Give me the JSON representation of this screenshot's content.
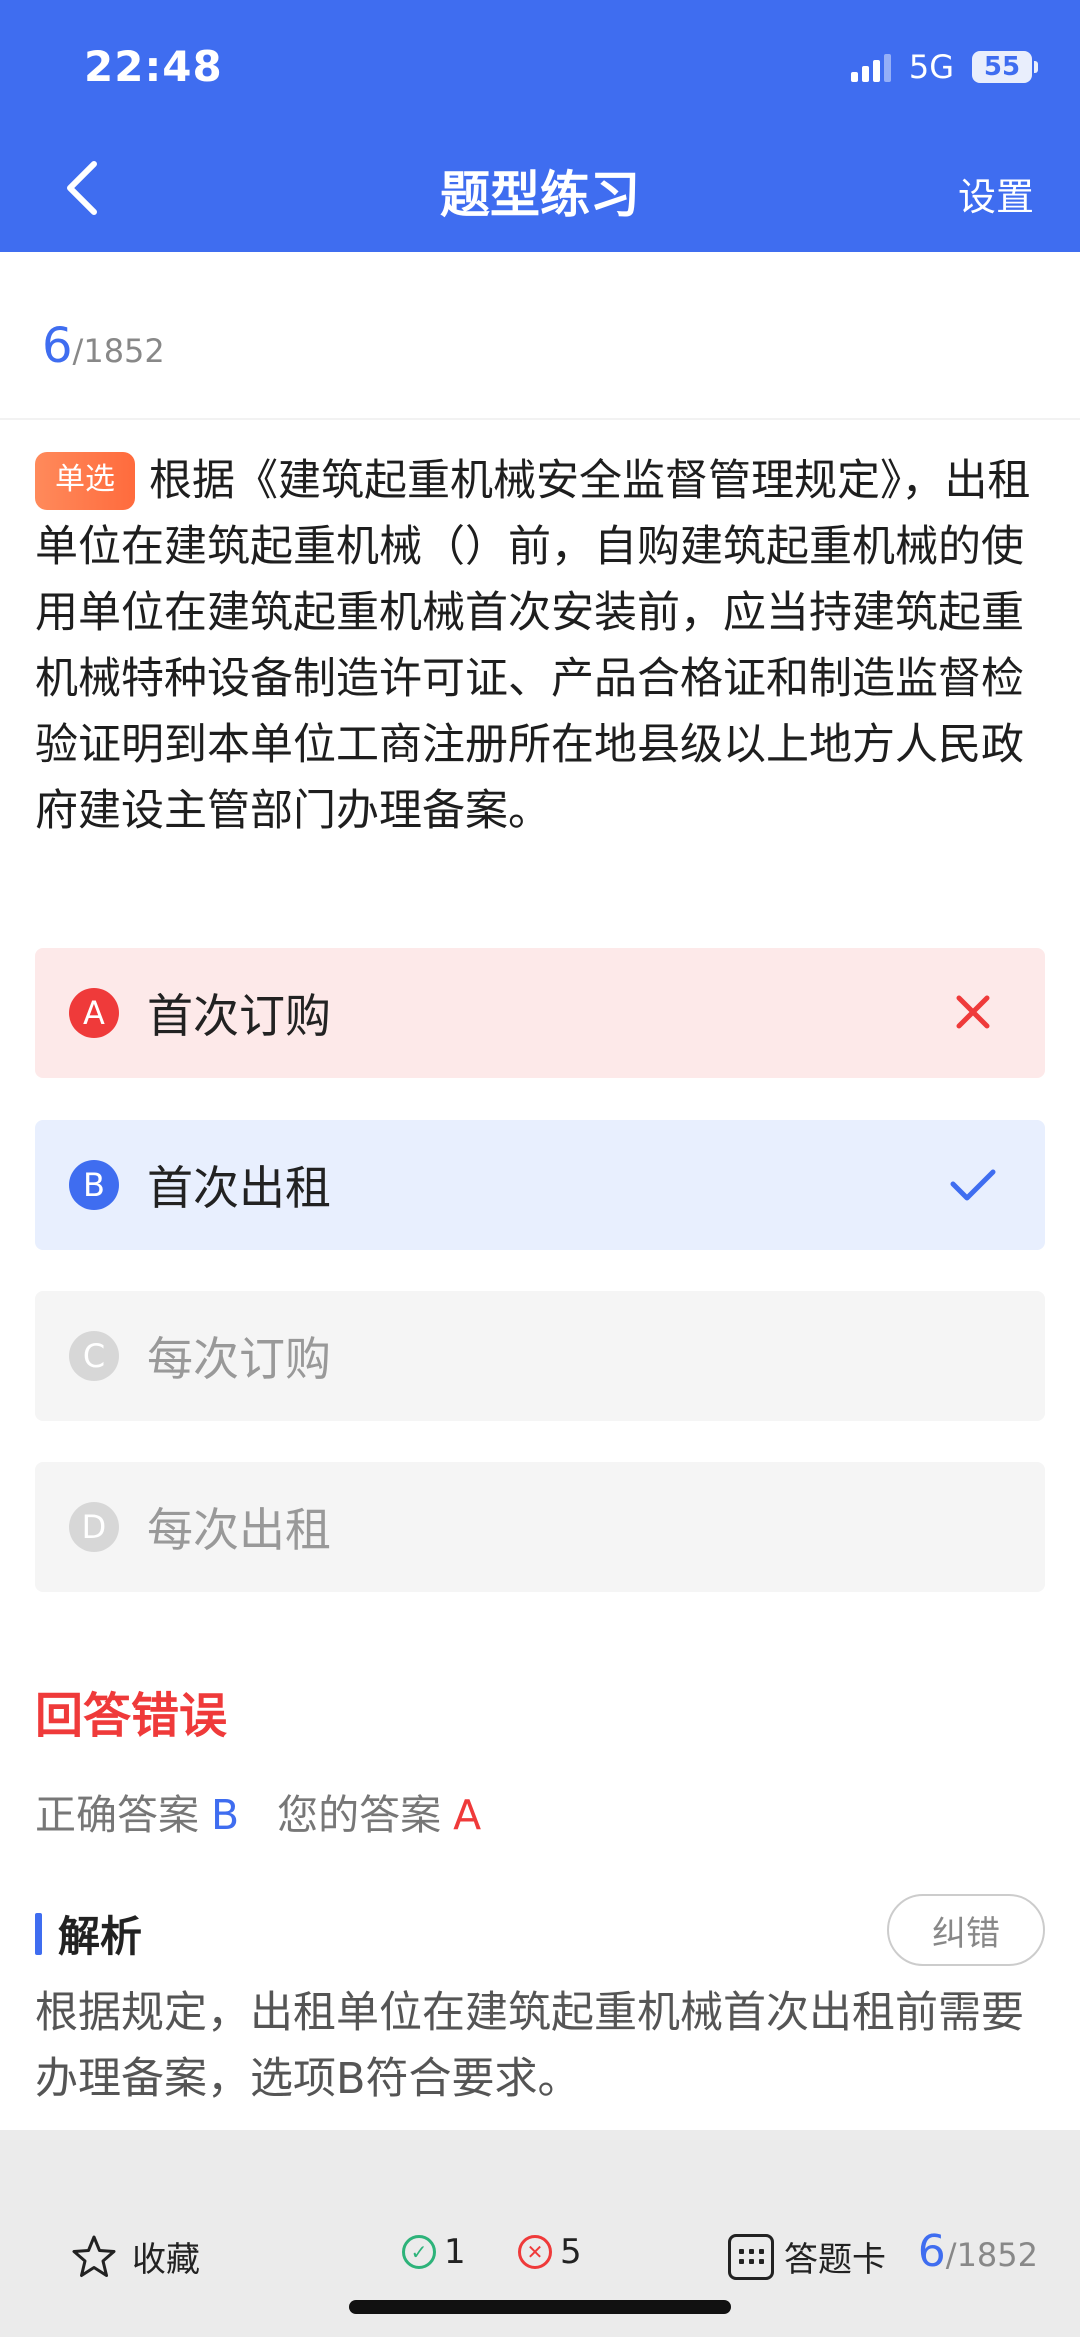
{
  "status": {
    "time": "22:48",
    "network": "5G",
    "battery": "55"
  },
  "nav": {
    "title": "题型练习",
    "settings": "设置"
  },
  "progress": {
    "current": "6",
    "total": "/1852"
  },
  "question": {
    "type_badge": "单选",
    "text": "根据《建筑起重机械安全监督管理规定》，出租单位在建筑起重机械（）前，自购建筑起重机械的使用单位在建筑起重机械首次安装前，应当持建筑起重机械特种设备制造许可证、产品合格证和制造监督检验证明到本单位工商注册所在地县级以上地方人民政府建设主管部门办理备案。"
  },
  "options": [
    {
      "letter": "A",
      "text": "首次订购",
      "state": "wrong"
    },
    {
      "letter": "B",
      "text": "首次出租",
      "state": "correct"
    },
    {
      "letter": "C",
      "text": "每次订购",
      "state": "neutral"
    },
    {
      "letter": "D",
      "text": "每次出租",
      "state": "neutral"
    }
  ],
  "result": {
    "title": "回答错误",
    "correct_label": "正确答案",
    "correct_value": "B",
    "mine_label": "您的答案",
    "mine_value": "A"
  },
  "analysis": {
    "title": "解析",
    "report_button": "纠错",
    "text": "根据规定，出租单位在建筑起重机械首次出租前需要办理备案，选项B符合要求。"
  },
  "bottom": {
    "favorite": "收藏",
    "right_count": "1",
    "wrong_count": "5",
    "card": "答题卡",
    "progress_current": "6",
    "progress_total": "/1852"
  },
  "colors": {
    "primary": "#3f6df0",
    "error": "#ef3a3a",
    "badge": "#ff6b3d"
  }
}
